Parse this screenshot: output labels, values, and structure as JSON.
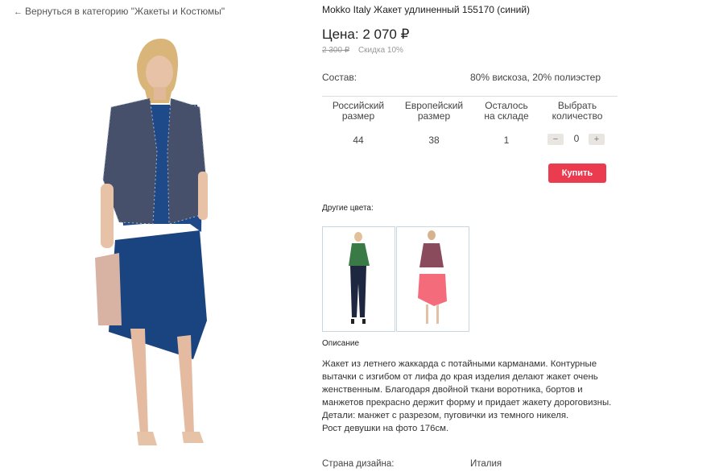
{
  "nav": {
    "back_arrow": "←",
    "back_label": "Вернуться в категорию \"Жакеты и Костюмы\""
  },
  "product": {
    "title": "Mokko Italy Жакет удлиненный 155170 (синий)",
    "price": "Цена: 2 070 ₽",
    "old_price": "2 300 ₽",
    "discount": "Скидка 10%",
    "composition_label": "Состав:",
    "composition_value": "80% вискоза, 20% полиэстер"
  },
  "size_table": {
    "headers": {
      "ru_size": [
        "Российский",
        "размер"
      ],
      "eu_size": [
        "Европейский",
        "размер"
      ],
      "stock": [
        "Осталось",
        "на складе"
      ],
      "qty": [
        "Выбрать",
        "количество"
      ]
    },
    "row": {
      "ru_size": "44",
      "eu_size": "38",
      "stock": "1"
    },
    "qty": {
      "minus": "−",
      "value": "0",
      "plus": "+"
    }
  },
  "buy_label": "Купить",
  "other_colors_label": "Другие цвета:",
  "thumbnails": [
    {
      "icon": "thumbnail-green-jacket"
    },
    {
      "icon": "thumbnail-pink-skirt"
    }
  ],
  "description": {
    "title": "Описание",
    "text": "Жакет из летнего жаккарда с потайными карманами. Контурные вытачки с изгибом от лифа до края изделия делают жакет очень женственным. Благодаря двойной ткани воротника, бортов и манжетов прекрасно держит форму и придает жакету дороговизны. Детали: манжет с разрезом, пуговички из темного никеля.",
    "height": "Рост девушки на фото 176см."
  },
  "country": {
    "label": "Страна дизайна:",
    "value": "Италия"
  },
  "colors": {
    "buy": "#ea3b4f",
    "thumb_border": "#c8d6e2"
  }
}
